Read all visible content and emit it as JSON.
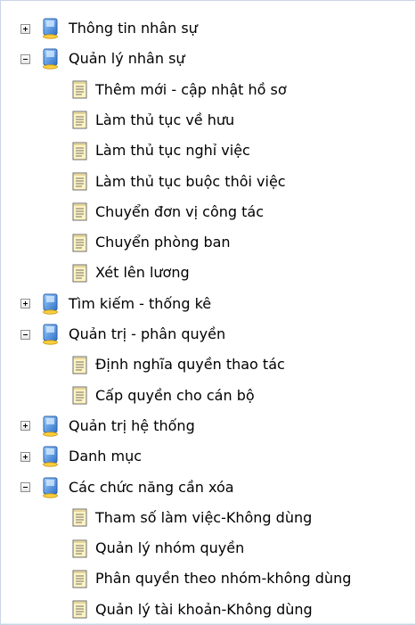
{
  "tree": {
    "nodes": [
      {
        "type": "group",
        "state": "collapsed",
        "icon": "computer-icon",
        "label": "Thông tin nhân sự"
      },
      {
        "type": "group",
        "state": "expanded",
        "icon": "computer-icon",
        "label": "Quản lý nhân sự"
      },
      {
        "type": "leaf",
        "icon": "document-icon",
        "label": "Thêm mới - cập nhật hồ sơ"
      },
      {
        "type": "leaf",
        "icon": "document-icon",
        "label": "Làm thủ tục về hưu"
      },
      {
        "type": "leaf",
        "icon": "document-icon",
        "label": "Làm thủ tục nghỉ việc"
      },
      {
        "type": "leaf",
        "icon": "document-icon",
        "label": "Làm thủ tục buộc thôi việc"
      },
      {
        "type": "leaf",
        "icon": "document-icon",
        "label": "Chuyển đơn vị công tác"
      },
      {
        "type": "leaf",
        "icon": "document-icon",
        "label": "Chuyển phòng ban"
      },
      {
        "type": "leaf",
        "icon": "document-icon",
        "label": "Xét lên lương"
      },
      {
        "type": "group",
        "state": "collapsed",
        "icon": "computer-icon",
        "label": "Tìm kiếm - thống kê"
      },
      {
        "type": "group",
        "state": "expanded",
        "icon": "computer-icon",
        "label": "Quản trị - phân quyền"
      },
      {
        "type": "leaf",
        "icon": "document-icon",
        "label": "Định nghĩa quyền thao tác"
      },
      {
        "type": "leaf",
        "icon": "document-icon",
        "label": "Cấp quyền cho cán bộ"
      },
      {
        "type": "group",
        "state": "collapsed",
        "icon": "computer-icon",
        "label": "Quản trị hệ thống"
      },
      {
        "type": "group",
        "state": "collapsed",
        "icon": "computer-icon",
        "label": "Danh mục"
      },
      {
        "type": "group",
        "state": "expanded",
        "icon": "computer-icon",
        "label": "Các chức năng cần xóa"
      },
      {
        "type": "leaf",
        "icon": "document-icon",
        "label": "Tham số làm việc-Không dùng"
      },
      {
        "type": "leaf",
        "icon": "document-icon",
        "label": "Quản lý nhóm quyền"
      },
      {
        "type": "leaf",
        "icon": "document-icon",
        "label": "Phân quyền theo nhóm-không dùng"
      },
      {
        "type": "leaf",
        "icon": "document-icon",
        "label": "Quản lý tài khoản-Không dùng"
      }
    ]
  },
  "colors": {
    "border": "#c9d6e6",
    "text": "#000000",
    "toggle_border": "#8f8f8f",
    "computer_blue": "#3a7fd5",
    "document_yellow": "#fff4c2"
  }
}
